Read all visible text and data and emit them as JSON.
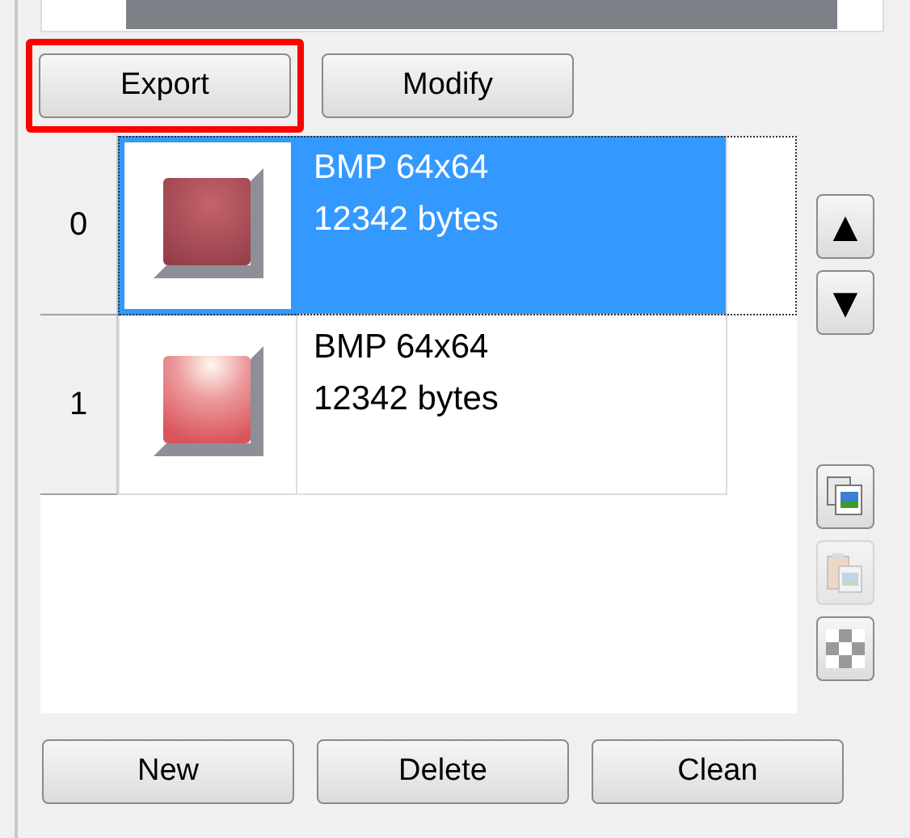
{
  "top_buttons": [
    {
      "label": "Export",
      "highlighted": true
    },
    {
      "label": "Modify",
      "highlighted": false
    }
  ],
  "rows": [
    {
      "index": "0",
      "kind": "dark",
      "lines": [
        "BMP 64x64",
        "12342 bytes"
      ],
      "selected": true
    },
    {
      "index": "1",
      "kind": "light",
      "lines": [
        "BMP 64x64",
        "12342 bytes"
      ],
      "selected": false
    }
  ],
  "move_buttons": [
    {
      "glyph": "▲"
    },
    {
      "glyph": "▼"
    }
  ],
  "tool_buttons": [
    {
      "kind": "copy",
      "disabled": false
    },
    {
      "kind": "paste",
      "disabled": true
    },
    {
      "kind": "transparency",
      "disabled": false
    }
  ],
  "bottom_buttons": [
    {
      "label": "New"
    },
    {
      "label": "Delete"
    },
    {
      "label": "Clean"
    }
  ]
}
